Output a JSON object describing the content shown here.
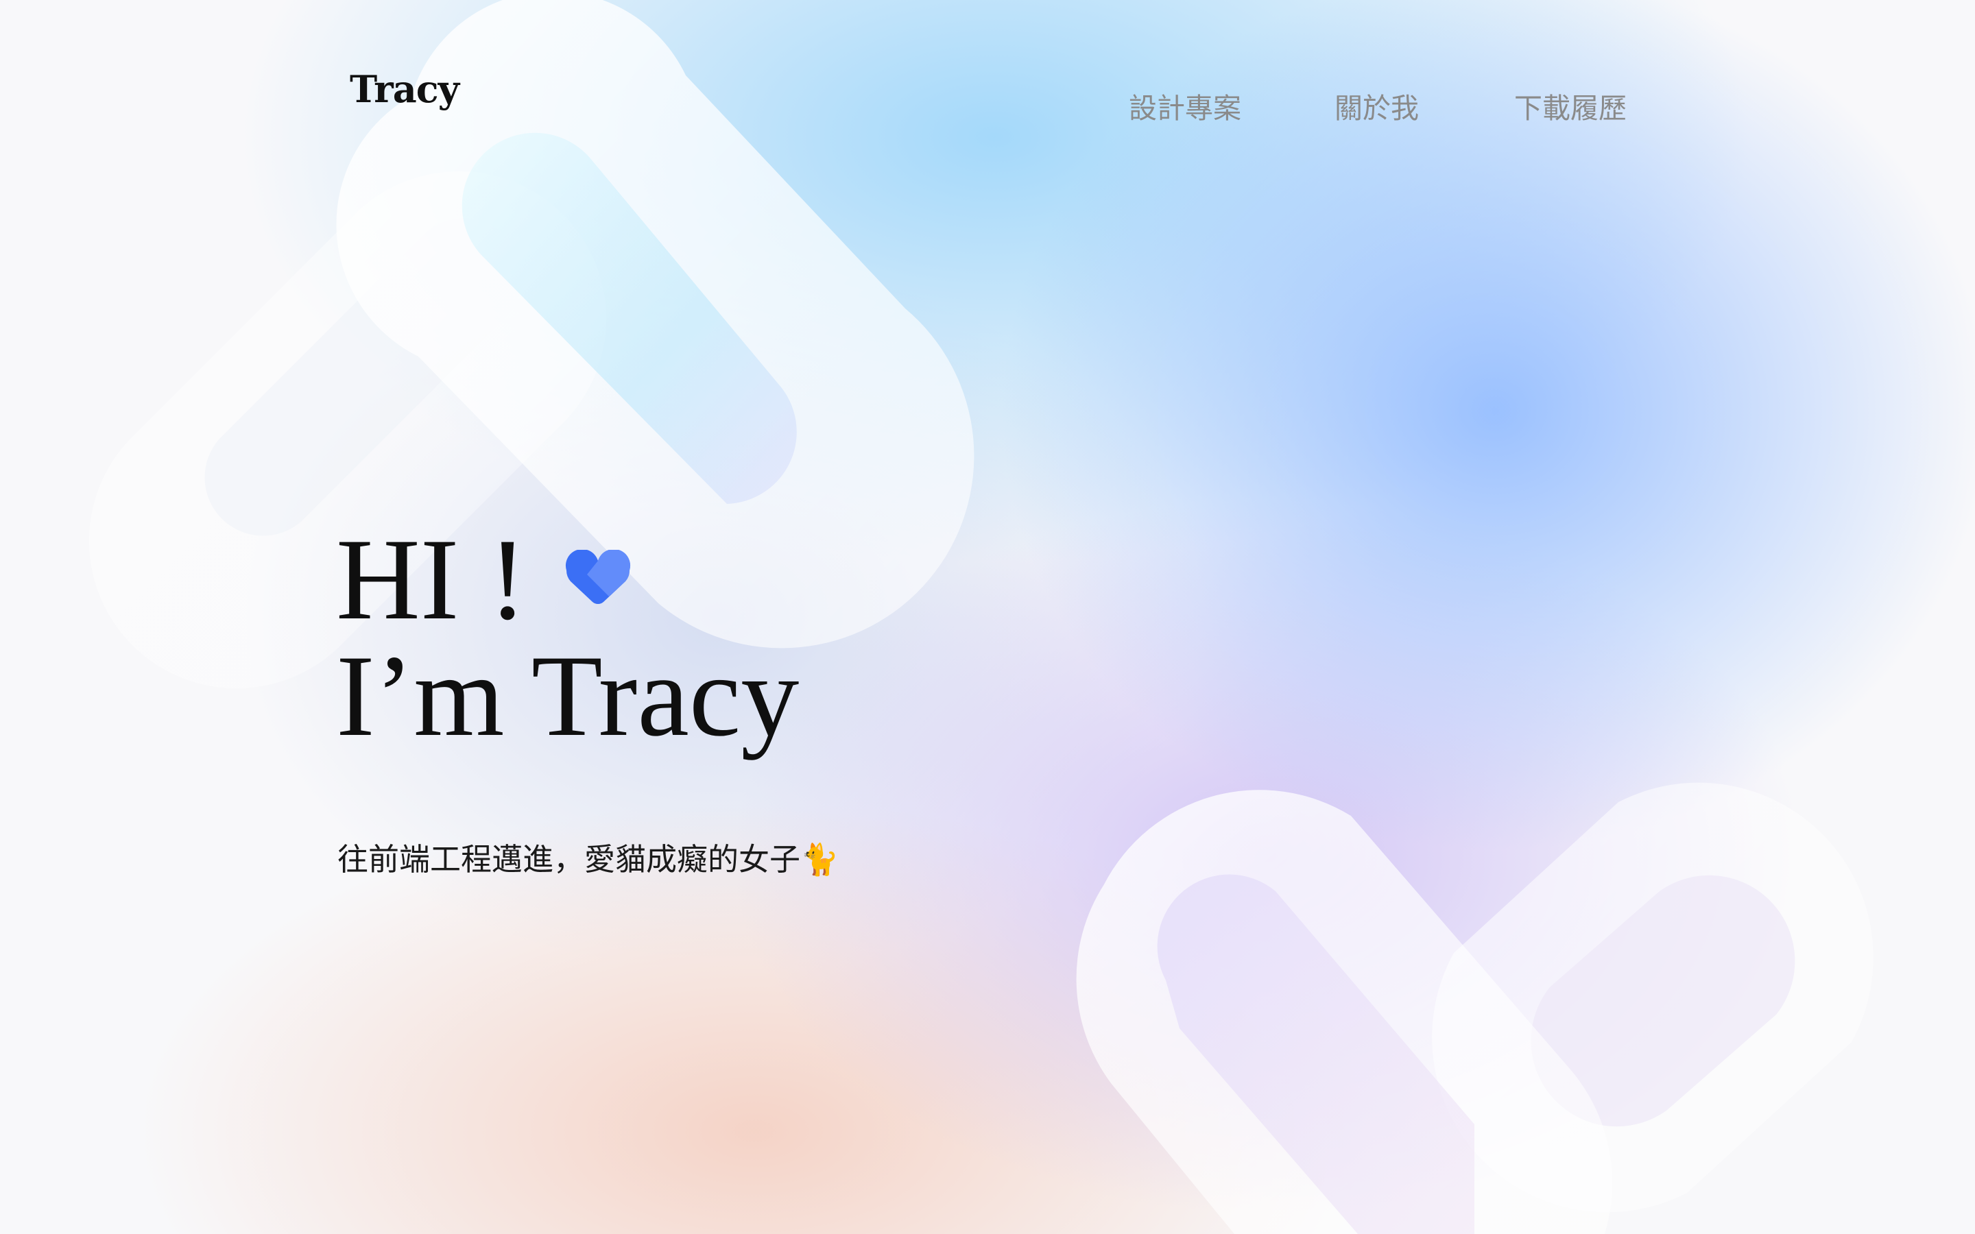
{
  "header": {
    "logo": "Tracy",
    "nav": [
      {
        "label": "設計專案"
      },
      {
        "label": "關於我"
      },
      {
        "label": "下載履歷"
      }
    ]
  },
  "hero": {
    "line1": "HI !",
    "line2": "I’m Tracy",
    "heart_icon": "heart-icon",
    "subtitle": "往前端工程邁進，愛貓成癡的女子🐈"
  },
  "colors": {
    "heart": "#3b6ff5",
    "heart_light": "#6a92fa",
    "text": "#0f0f0f",
    "nav_text": "#8a8a8a"
  }
}
